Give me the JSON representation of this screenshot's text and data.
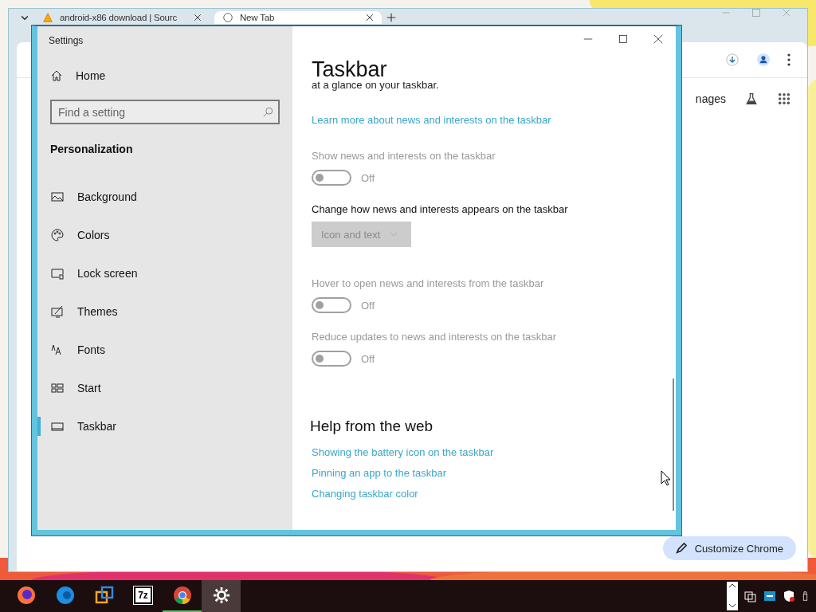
{
  "browser": {
    "tabs": [
      {
        "title": "android-x86 download | Sourc",
        "selected": false
      },
      {
        "title": "New Tab",
        "selected": true
      }
    ],
    "images_link": "nages",
    "customize_button": "Customize Chrome"
  },
  "settings": {
    "title": "Settings",
    "home": "Home",
    "search_placeholder": "Find a setting",
    "section": "Personalization",
    "nav": [
      {
        "label": "Background",
        "selected": false
      },
      {
        "label": "Colors",
        "selected": false
      },
      {
        "label": "Lock screen",
        "selected": false
      },
      {
        "label": "Themes",
        "selected": false
      },
      {
        "label": "Fonts",
        "selected": false
      },
      {
        "label": "Start",
        "selected": false
      },
      {
        "label": "Taskbar",
        "selected": true
      }
    ],
    "page_title": "Taskbar",
    "intro_fragment": "at a glance on your taskbar.",
    "learn_link": "Learn more about news and interests on the taskbar",
    "options": [
      {
        "kind": "toggle",
        "label": "Show news and interests on the taskbar",
        "on": false,
        "disabled": true,
        "state_text": "Off"
      },
      {
        "kind": "dropdown",
        "label": "Change how news and interests appears on the taskbar",
        "value": "Icon and text",
        "disabled": true
      },
      {
        "kind": "toggle",
        "label": "Hover to open news and interests from the taskbar",
        "on": false,
        "disabled": true,
        "state_text": "Off"
      },
      {
        "kind": "toggle",
        "label": "Reduce updates to news and interests on the taskbar",
        "on": false,
        "disabled": true,
        "state_text": "Off"
      }
    ],
    "help": {
      "title": "Help from the web",
      "links": [
        "Showing the battery icon on the taskbar",
        "Pinning an app to the taskbar",
        "Changing taskbar color"
      ]
    }
  },
  "taskbar": {
    "apps": [
      {
        "kind": "firefox",
        "selected": false,
        "running": false
      },
      {
        "kind": "edge",
        "selected": false,
        "running": false
      },
      {
        "kind": "vm",
        "selected": false,
        "running": false
      },
      {
        "kind": "archive",
        "label": "7z",
        "selected": false,
        "running": false
      },
      {
        "kind": "chrome",
        "selected": false,
        "running": true
      },
      {
        "kind": "gear",
        "selected": true,
        "running": false
      }
    ]
  }
}
